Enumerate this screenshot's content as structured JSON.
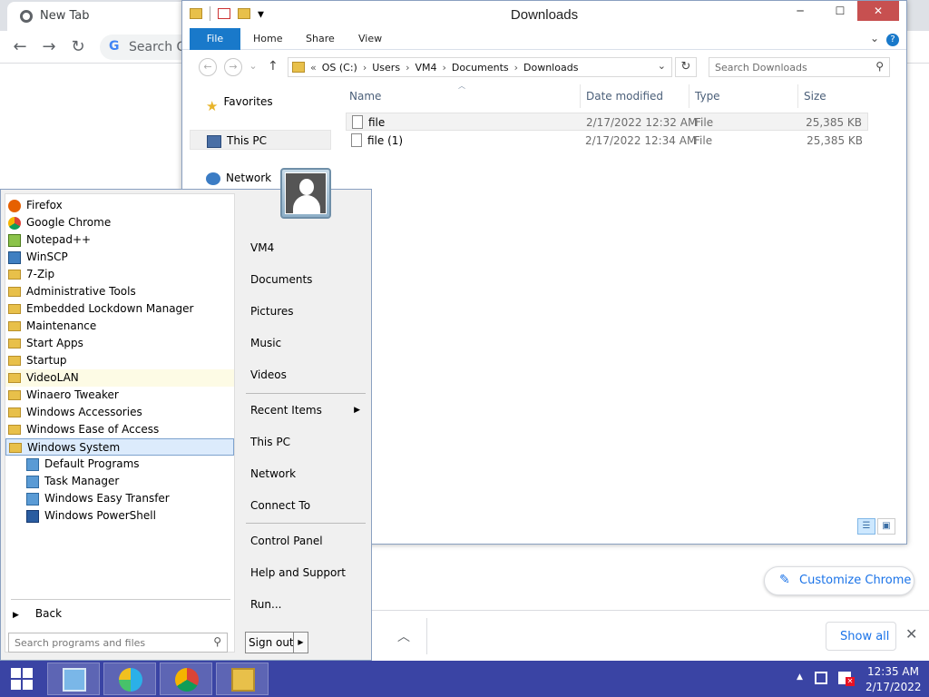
{
  "chrome": {
    "tab_title": "New Tab",
    "omnibox_placeholder": "Search Go",
    "customize_label": "Customize Chrome",
    "show_all_label": "Show all"
  },
  "explorer": {
    "title": "Downloads",
    "ribbon_tabs": [
      "File",
      "Home",
      "Share",
      "View"
    ],
    "breadcrumb": [
      "OS (C:)",
      "Users",
      "VM4",
      "Documents",
      "Downloads"
    ],
    "search_placeholder": "Search Downloads",
    "nav": {
      "favorites": "Favorites",
      "this_pc": "This PC",
      "network": "Network"
    },
    "columns": [
      "Name",
      "Date modified",
      "Type",
      "Size"
    ],
    "files": [
      {
        "name": "file",
        "date": "2/17/2022 12:32 AM",
        "type": "File",
        "size": "25,385 KB"
      },
      {
        "name": "file (1)",
        "date": "2/17/2022 12:34 AM",
        "type": "File",
        "size": "25,385 KB"
      }
    ]
  },
  "start_menu": {
    "programs": [
      {
        "label": "Firefox",
        "icon": "firefox-icon"
      },
      {
        "label": "Google Chrome",
        "icon": "chrome-icon"
      },
      {
        "label": "Notepad++",
        "icon": "notepadpp-icon"
      },
      {
        "label": "WinSCP",
        "icon": "winscp-icon"
      },
      {
        "label": "7-Zip",
        "icon": "folder-icon"
      },
      {
        "label": "Administrative Tools",
        "icon": "folder-icon"
      },
      {
        "label": "Embedded Lockdown Manager",
        "icon": "folder-icon"
      },
      {
        "label": "Maintenance",
        "icon": "folder-icon"
      },
      {
        "label": "Start Apps",
        "icon": "folder-icon"
      },
      {
        "label": "Startup",
        "icon": "folder-icon"
      },
      {
        "label": "VideoLAN",
        "icon": "folder-icon"
      },
      {
        "label": "Winaero Tweaker",
        "icon": "folder-icon"
      },
      {
        "label": "Windows Accessories",
        "icon": "folder-icon"
      },
      {
        "label": "Windows Ease of Access",
        "icon": "folder-icon"
      },
      {
        "label": "Windows System",
        "icon": "folder-icon"
      },
      {
        "label": "Default Programs",
        "icon": "default-programs-icon"
      },
      {
        "label": "Task Manager",
        "icon": "task-manager-icon"
      },
      {
        "label": "Windows Easy Transfer",
        "icon": "easy-transfer-icon"
      },
      {
        "label": "Windows PowerShell",
        "icon": "powershell-icon"
      }
    ],
    "back_label": "Back",
    "search_placeholder": "Search programs and files",
    "right_items": {
      "user": "VM4",
      "documents": "Documents",
      "pictures": "Pictures",
      "music": "Music",
      "videos": "Videos",
      "recent_items": "Recent Items",
      "this_pc": "This PC",
      "network": "Network",
      "connect_to": "Connect To",
      "control_panel": "Control Panel",
      "help_support": "Help and Support",
      "run": "Run..."
    },
    "signout_label": "Sign out"
  },
  "taskbar": {
    "clock_time": "12:35 AM",
    "clock_date": "2/17/2022"
  },
  "colors": {
    "taskbar": "#3a44a4",
    "ribbon_file": "#1979ca",
    "selection": "#dcebfc",
    "chrome_accent": "#1a73e8"
  }
}
